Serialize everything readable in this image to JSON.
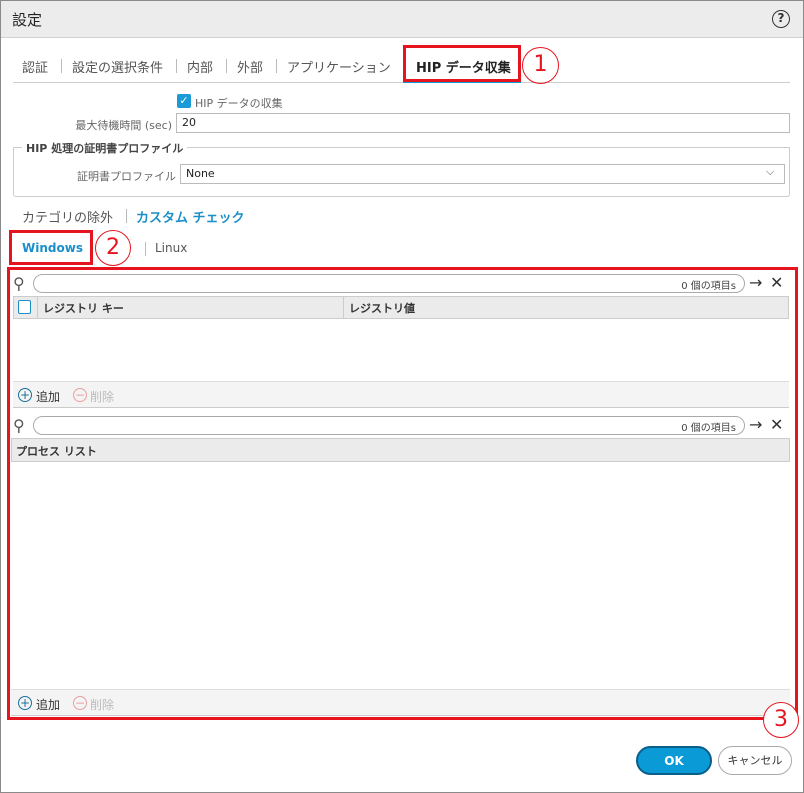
{
  "dialog": {
    "title": "設定",
    "help_icon": "question-circle-icon"
  },
  "tabs": [
    {
      "label": "認証"
    },
    {
      "label": "設定の選択条件"
    },
    {
      "label": "内部"
    },
    {
      "label": "外部"
    },
    {
      "label": "アプリケーション"
    },
    {
      "label": "HIP データ収集",
      "active": true
    }
  ],
  "annotations": {
    "one": "1",
    "two": "2",
    "three": "3",
    "color": "#e6141e"
  },
  "hip": {
    "collect_label": "HIP データの収集",
    "collect_checked": true,
    "max_wait_label": "最大待機時間 (sec)",
    "max_wait_value": "20"
  },
  "cert": {
    "legend": "HIP 処理の証明書プロファイル",
    "label": "証明書プロファイル",
    "value": "None"
  },
  "subtabs": [
    {
      "label": "カテゴリの除外"
    },
    {
      "label": "カスタム チェック",
      "active": true
    }
  ],
  "os_tabs": [
    {
      "label": "Windows",
      "active": true
    },
    {
      "label": "Linux"
    }
  ],
  "registry": {
    "count": "0 個の項目s",
    "columns": [
      "レジストリ キー",
      "レジストリ値"
    ],
    "rows": [],
    "add": "追加",
    "delete": "削除"
  },
  "process": {
    "count": "0 個の項目s",
    "columns": [
      "プロセス リスト"
    ],
    "rows": [],
    "add": "追加",
    "delete": "削除"
  },
  "buttons": {
    "ok": "OK",
    "cancel": "キャンセル"
  },
  "colors": {
    "accent": "#0a9ad6",
    "active_text": "#1a8fc9"
  }
}
